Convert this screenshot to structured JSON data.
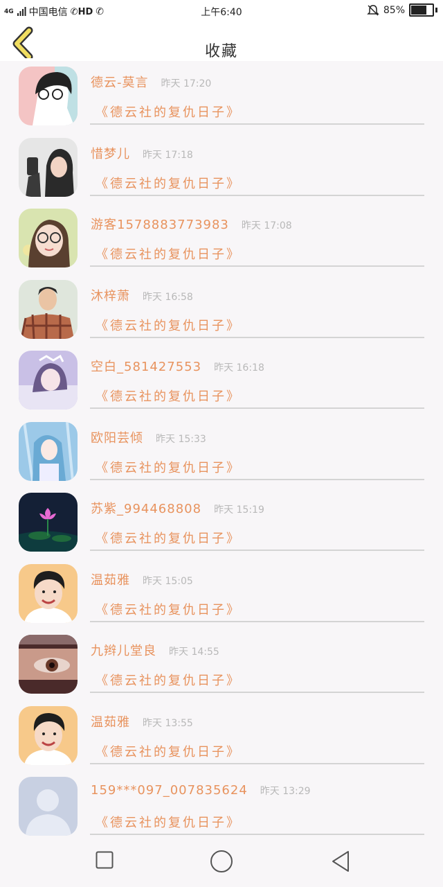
{
  "status_bar": {
    "signal_label": "4G",
    "carrier": "中国电信",
    "hd_label": "HD",
    "time": "上午6:40",
    "battery_text": "85%",
    "battery_level": 0.85
  },
  "header": {
    "title": "收藏"
  },
  "favorites": [
    {
      "name": "德云-莫言",
      "time": "昨天 17:20",
      "subtitle": "《德云社的复仇日子》",
      "avatar": "illustrated-man-glasses"
    },
    {
      "name": "惜梦儿",
      "time": "昨天 17:18",
      "subtitle": "《德云社的复仇日子》",
      "avatar": "girl-selfie"
    },
    {
      "name": "游客1578883773983",
      "time": "昨天 17:08",
      "subtitle": "《德云社的复仇日子》",
      "avatar": "girl-glasses"
    },
    {
      "name": "沐梓萧",
      "time": "昨天 16:58",
      "subtitle": "《德云社的复仇日子》",
      "avatar": "boy-plaid-shirt"
    },
    {
      "name": "空白_581427553",
      "time": "昨天 16:18",
      "subtitle": "《德云社的复仇日子》",
      "avatar": "girl-purple"
    },
    {
      "name": "欧阳芸倾",
      "time": "昨天 15:33",
      "subtitle": "《德云社的复仇日子》",
      "avatar": "anime-girl-blue"
    },
    {
      "name": "苏紫_994468808",
      "time": "昨天 15:19",
      "subtitle": "《德云社的复仇日子》",
      "avatar": "lotus-night"
    },
    {
      "name": "温茹雅",
      "time": "昨天 15:05",
      "subtitle": "《德云社的复仇日子》",
      "avatar": "boy-smiling"
    },
    {
      "name": "九辫儿堂良",
      "time": "昨天 14:55",
      "subtitle": "《德云社的复仇日子》",
      "avatar": "eye-closeup"
    },
    {
      "name": "温茹雅",
      "time": "昨天 13:55",
      "subtitle": "《德云社的复仇日子》",
      "avatar": "boy-smiling"
    },
    {
      "name": "159***097_007835624",
      "time": "昨天 13:29",
      "subtitle": "《德云社的复仇日子》",
      "avatar": "default-user"
    }
  ],
  "colors": {
    "accent": "#e8935e",
    "back_icon": "#f0dd60",
    "time": "#b8b8b8",
    "background": "#f8f6f8"
  }
}
